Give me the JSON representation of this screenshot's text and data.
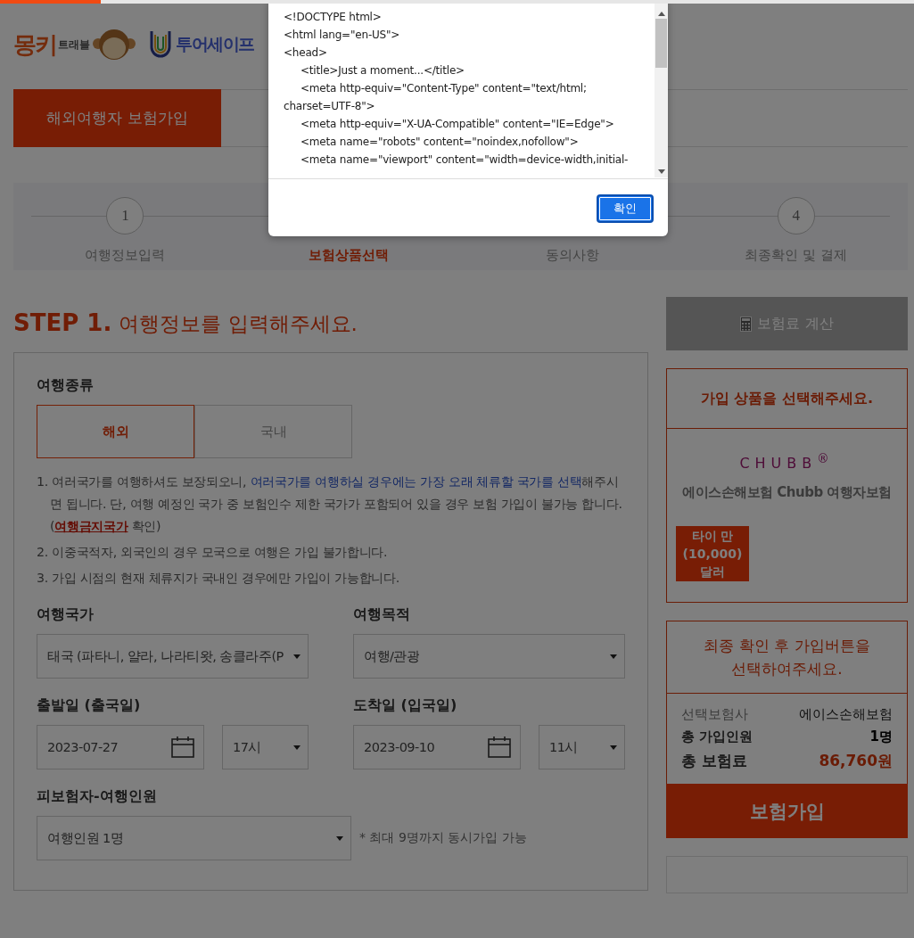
{
  "loading_bar": {
    "level": 0.11
  },
  "header": {
    "logos": [
      {
        "kind": "monkey",
        "text": "몽키",
        "subtext": "트래블"
      },
      {
        "kind": "tour",
        "text": "투어세이프"
      }
    ]
  },
  "tabs": [
    {
      "label": "해외여행자 보험가입",
      "selected": true
    }
  ],
  "steps": [
    {
      "number": "1",
      "label": "여행정보입력",
      "selected": false
    },
    {
      "label": "보험상품선택",
      "selected": true
    },
    {
      "label": "동의사항",
      "selected": false
    },
    {
      "number": "4",
      "label": "최종확인 및 결제",
      "selected": false
    }
  ],
  "heading": {
    "step": "STEP 1.",
    "title": "여행정보를 입력해주세요."
  },
  "form": {
    "trip_type": {
      "label": "여행종류",
      "options": [
        {
          "label": "해외",
          "selected": true
        },
        {
          "label": "국내",
          "selected": false
        }
      ]
    },
    "notes": [
      {
        "segments": [
          {
            "kind": "plain",
            "text": "1. 여러국가를 여행하셔도 보장되오니, "
          },
          {
            "kind": "highlight",
            "text": "여러국가를 여행하실 경우에는 가장 오래 체류할 국가를 선택"
          },
          {
            "kind": "plain",
            "text": "해주시면 됩니다. 단, 여행 예정인 국가 중 보험인수 제한 국가가 포함되어 있을 경우 보험 가입이 불가능 합니다. ("
          },
          {
            "kind": "link",
            "text": "여행금지국가"
          },
          {
            "kind": "plain",
            "text": " 확인)"
          }
        ]
      },
      {
        "segments": [
          {
            "kind": "plain",
            "text": "2. 이중국적자, 외국인의 경우 모국으로 여행은 가입 불가합니다."
          }
        ]
      },
      {
        "segments": [
          {
            "kind": "plain",
            "text": "3. 가입 시점의 현재 체류지가 국내인 경우에만 가입이 가능합니다."
          }
        ]
      }
    ],
    "fields": [
      {
        "label": "여행국가",
        "controls": [
          {
            "kind": "select",
            "value": "태국 (파타니, 얄라, 나라티왓, 송클라주(P"
          }
        ]
      },
      {
        "label": "여행목적",
        "controls": [
          {
            "kind": "select",
            "value": "여행/관광"
          }
        ]
      },
      {
        "label": "출발일 (출국일)",
        "controls": [
          {
            "kind": "date",
            "value": "2023-07-27"
          },
          {
            "kind": "select",
            "value": "17시"
          }
        ]
      },
      {
        "label": "도착일 (입국일)",
        "controls": [
          {
            "kind": "date",
            "value": "2023-09-10"
          },
          {
            "kind": "select",
            "value": "11시"
          }
        ]
      }
    ],
    "travelers": {
      "label": "피보험자-여행인원",
      "value": "여행인원 1명",
      "hint": "* 최대 9명까지 동시가입 가능"
    }
  },
  "sidebar": {
    "calc_button": "보험료 계산",
    "product_card": {
      "title": "가입 상품을 선택해주세요.",
      "brand": "CHUBB$^{®}$",
      "name": "에이스손해보험 Chubb 여행자보험",
      "badge": "타이 만 (10,000)달러"
    },
    "summary_card": {
      "title": "최종 확인 후 가입버튼을 선택하여주세요.",
      "rows": [
        {
          "label": "선택보험사",
          "value": "에이스손해보험",
          "kind": "plain"
        },
        {
          "label": "총 가입인원",
          "value": "1명",
          "kind": "bold"
        },
        {
          "label": "총 보험료",
          "value": "86,760원",
          "kind": "price"
        }
      ],
      "button": "보험가입"
    }
  },
  "dialog": {
    "lines": [
      {
        "text": "<!DOCTYPE html>",
        "indent": false
      },
      {
        "text": "<html lang=\"en-US\">",
        "indent": false
      },
      {
        "text": "<head>",
        "indent": false
      },
      {
        "text": "<title>Just a moment...</title>",
        "indent": true
      },
      {
        "text": "<meta http-equiv=\"Content-Type\" content=\"text/html; charset=UTF-8\">",
        "indent": true
      },
      {
        "text": "<meta http-equiv=\"X-UA-Compatible\" content=\"IE=Edge\">",
        "indent": true
      },
      {
        "text": "<meta name=\"robots\" content=\"noindex,nofollow\">",
        "indent": true
      },
      {
        "text": "<meta name=\"viewport\" content=\"width=device-width,initial-",
        "indent": true
      }
    ],
    "button": "확인"
  }
}
